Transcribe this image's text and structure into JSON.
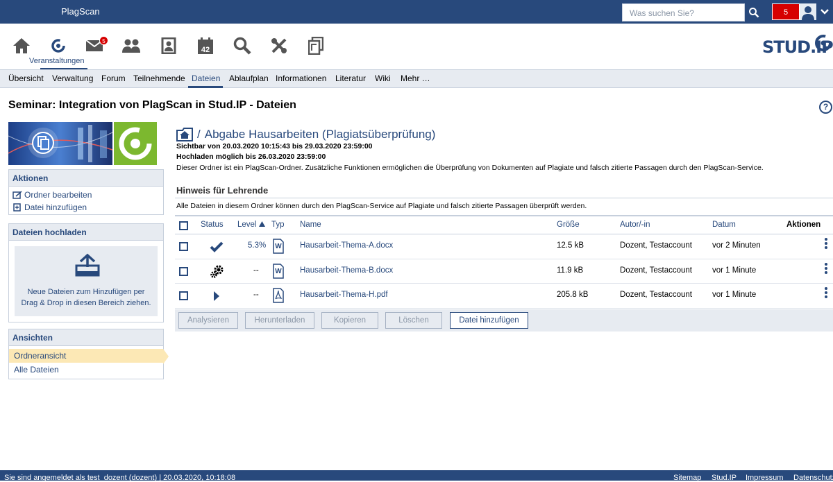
{
  "header": {
    "app_title": "PlagScan",
    "search_placeholder": "Was suchen Sie?",
    "notification_count": "5"
  },
  "iconnav": {
    "active_label": "Veranstaltungen",
    "messages_badge": "5",
    "calendar_day": "42",
    "logo": "STUD.IP"
  },
  "tabs": [
    "Übersicht",
    "Verwaltung",
    "Forum",
    "Teilnehmende",
    "Dateien",
    "Ablaufplan",
    "Informationen",
    "Literatur",
    "Wiki",
    "Mehr …"
  ],
  "page_title": "Seminar: Integration von PlagScan in Stud.IP - Dateien",
  "sidebar": {
    "actions_title": "Aktionen",
    "actions": [
      "Ordner bearbeiten",
      "Datei hinzufügen"
    ],
    "upload_title": "Dateien hochladen",
    "upload_text_1": "Neue Dateien zum Hinzufügen per",
    "upload_text_2": "Drag & Drop in diesen Bereich ziehen.",
    "views_title": "Ansichten",
    "views": [
      "Ordneransicht",
      "Alle Dateien"
    ]
  },
  "folder": {
    "separator": "/",
    "name": "Abgabe Hausarbeiten (Plagiatsüberprüfung)",
    "visible": "Sichtbar von 20.03.2020 10:15:43 bis 29.03.2020 23:59:00",
    "upload_until": "Hochladen möglich bis 26.03.2020 23:59:00",
    "description": "Dieser Ordner ist ein PlagScan-Ordner. Zusätzliche Funktionen ermöglichen die Überprüfung von Dokumenten auf Plagiate und falsch zitierte Passagen durch den PlagScan-Service.",
    "hint_title": "Hinweis für Lehrende",
    "hint_text": "Alle Dateien in diesem Ordner können durch den PlagScan-Service auf Plagiate und falsch zitierte Passagen überprüft werden."
  },
  "table": {
    "headers": {
      "status": "Status",
      "level": "Level",
      "typ": "Typ",
      "name": "Name",
      "size": "Größe",
      "author": "Autor/-in",
      "date": "Datum",
      "actions": "Aktionen"
    },
    "rows": [
      {
        "status_icon": "checkmark-icon",
        "level": "5.3%",
        "type_icon": "word-document-icon",
        "name": "Hausarbeit-Thema-A.docx",
        "size": "12.5 kB",
        "author": "Dozent, Testaccount",
        "date": "vor 2 Minuten"
      },
      {
        "status_icon": "gears-icon",
        "level": "--",
        "type_icon": "word-document-icon",
        "name": "Hausarbeit-Thema-B.docx",
        "size": "11.9 kB",
        "author": "Dozent, Testaccount",
        "date": "vor 1 Minute"
      },
      {
        "status_icon": "play-icon",
        "level": "--",
        "type_icon": "pdf-document-icon",
        "name": "Hausarbeit-Thema-H.pdf",
        "size": "205.8 kB",
        "author": "Dozent, Testaccount",
        "date": "vor 1 Minute"
      }
    ],
    "buttons": [
      "Analysieren",
      "Herunterladen",
      "Kopieren",
      "Löschen",
      "Datei hinzufügen"
    ]
  },
  "footer": {
    "login_info": "Sie sind angemeldet als test_dozent (dozent) | 20.03.2020, 10:18:08",
    "links": [
      "Sitemap",
      "Stud.IP",
      "Impressum",
      "Datenschutz"
    ]
  },
  "colors": {
    "brand": "#28497c",
    "alert": "#d60000",
    "panel": "#e7ebf1",
    "highlight": "#fce8b5"
  }
}
